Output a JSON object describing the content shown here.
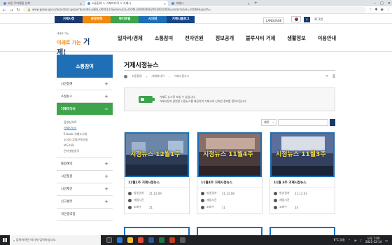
{
  "browser": {
    "tabs": [
      {
        "label": "비응 주의앵을 선착"
      },
      {
        "label": "소통참여 > 거제미디어 > 거제시"
      },
      {
        "label": "거제시"
      }
    ],
    "new_tab": "+",
    "url": "www.geoje.go.kr/board/list.geoje?boardId=BBS_0000122&menuCd=DOM_000000802003001000&contentsSid=10069&cpath="
  },
  "site_top": {
    "menus": [
      "거제시청",
      "관광문화",
      "복지포털",
      "시의회",
      "거제시블로그"
    ],
    "language": "LANGUAGE",
    "login": "로그인"
  },
  "logo": {
    "small": "세계로 가는",
    "brand": "거제!",
    "sub": "미래로 가는"
  },
  "gnb": [
    "일자리/경제",
    "소통참여",
    "전자민원",
    "정보공개",
    "블루시티 거제",
    "생활정보",
    "이용안내"
  ],
  "lnb": {
    "title": "소통참여",
    "items_top": [
      {
        "label": "시민참여",
        "mark": "+"
      },
      {
        "label": "소셜뉴스",
        "mark": "+"
      }
    ],
    "active": {
      "label": "거제미디어",
      "mark": "−"
    },
    "subitems": [
      {
        "label": "동영상자료"
      },
      {
        "label": "거제시뉴스"
      },
      {
        "label": "E-book 거제소식지"
      },
      {
        "label": "소식지 무료구독신청"
      },
      {
        "label": "보도자료"
      },
      {
        "label": "인터넷방송국"
      }
    ],
    "items_bottom": [
      {
        "label": "통합예약",
        "mark": "+"
      },
      {
        "label": "시민청원",
        "mark": "+"
      },
      {
        "label": "시민제안",
        "mark": "+"
      },
      {
        "label": "신고센터",
        "mark": "+"
      },
      {
        "label": "국민생각함",
        "mark": ""
      }
    ]
  },
  "content": {
    "title": "거제시정뉴스",
    "breadcrumb": [
      "소통참여",
      "거제미디어",
      "거제시정뉴스"
    ],
    "info_line1": "거제도 뉴스로 보실 수 있습니다.",
    "info_line2": "거제시정과 관련한 시정뉴스를 제공하여 거제시의 신속한 정보를 알려드립니다.",
    "search_select": "제목",
    "cards": [
      {
        "thumb_text": "시정뉴스 12월1주",
        "title": "12월1주 거제시정뉴스",
        "date_label": "방송일자",
        "date": "21.12.09",
        "time_label": "재생시간",
        "time": "",
        "views_label": "조회수",
        "views": "21"
      },
      {
        "thumb_text": "시정뉴스 11월4주",
        "title": "11월4주 거제시정뉴스",
        "date_label": "방송일자",
        "date": "21.12.08",
        "time_label": "재생시간",
        "time": "",
        "views_label": "조회수",
        "views": "11"
      },
      {
        "thumb_text": "시정뉴스 11월3주",
        "title": "11월 3주 거제시정뉴스",
        "date_label": "방송일자",
        "date": "21.12.03",
        "time_label": "재생시간",
        "time": "",
        "views_label": "조회수",
        "views": "24"
      }
    ]
  },
  "taskbar": {
    "search_placeholder": "검색하려면 여기에 입력하십시오.",
    "weather": "6°C 공청",
    "time": "오후 7:00",
    "date": "2021-12-14"
  }
}
